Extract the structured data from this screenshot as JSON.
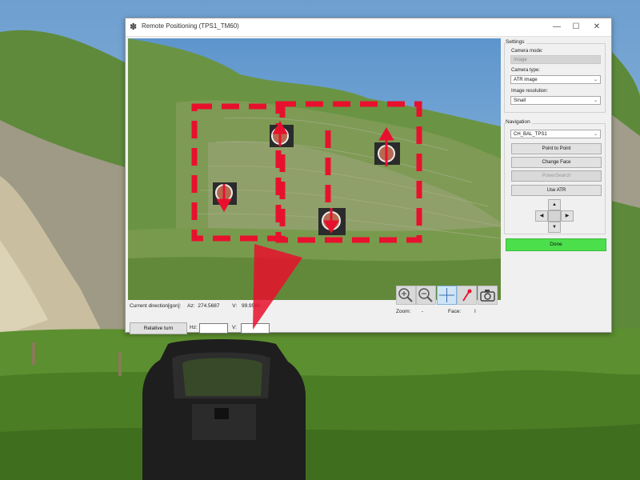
{
  "window": {
    "title": "Remote Positioning (TPS1_TM60)",
    "minimize": "—",
    "maximize": "☐",
    "close": "✕"
  },
  "status": {
    "direction_label": "Current direction[gon]:",
    "hz_label": "Az:",
    "hz_value": "274.5687",
    "v_label": "V:",
    "v_value": "99.9580"
  },
  "relative_turn": {
    "button": "Relative turn",
    "hz_label": "Hz:",
    "v_label": "V:"
  },
  "tools": {
    "zoom_label": "Zoom:",
    "zoom_value": "-",
    "face_label": "Face:",
    "face_value": "I"
  },
  "settings": {
    "group_label": "Settings",
    "camera_mode_label": "Camera mode:",
    "camera_mode_value": "Image",
    "camera_type_label": "Camera type:",
    "camera_type_value": "ATR image",
    "resolution_label": "Image resolution:",
    "resolution_value": "Small"
  },
  "navigation": {
    "group_label": "Navigation",
    "station_value": "CH_BAL_TPS1",
    "point_to_point": "Point to Point",
    "change_face": "Change Face",
    "power_search": "PowerSearch",
    "use_atr": "Use ATR",
    "up": "▲",
    "down": "▼",
    "left": "◀",
    "right": "▶"
  },
  "done": "Done",
  "colors": {
    "accent_red": "#e8112d",
    "done_green": "#4cdf4c",
    "window_bg": "#f0f0f0"
  }
}
